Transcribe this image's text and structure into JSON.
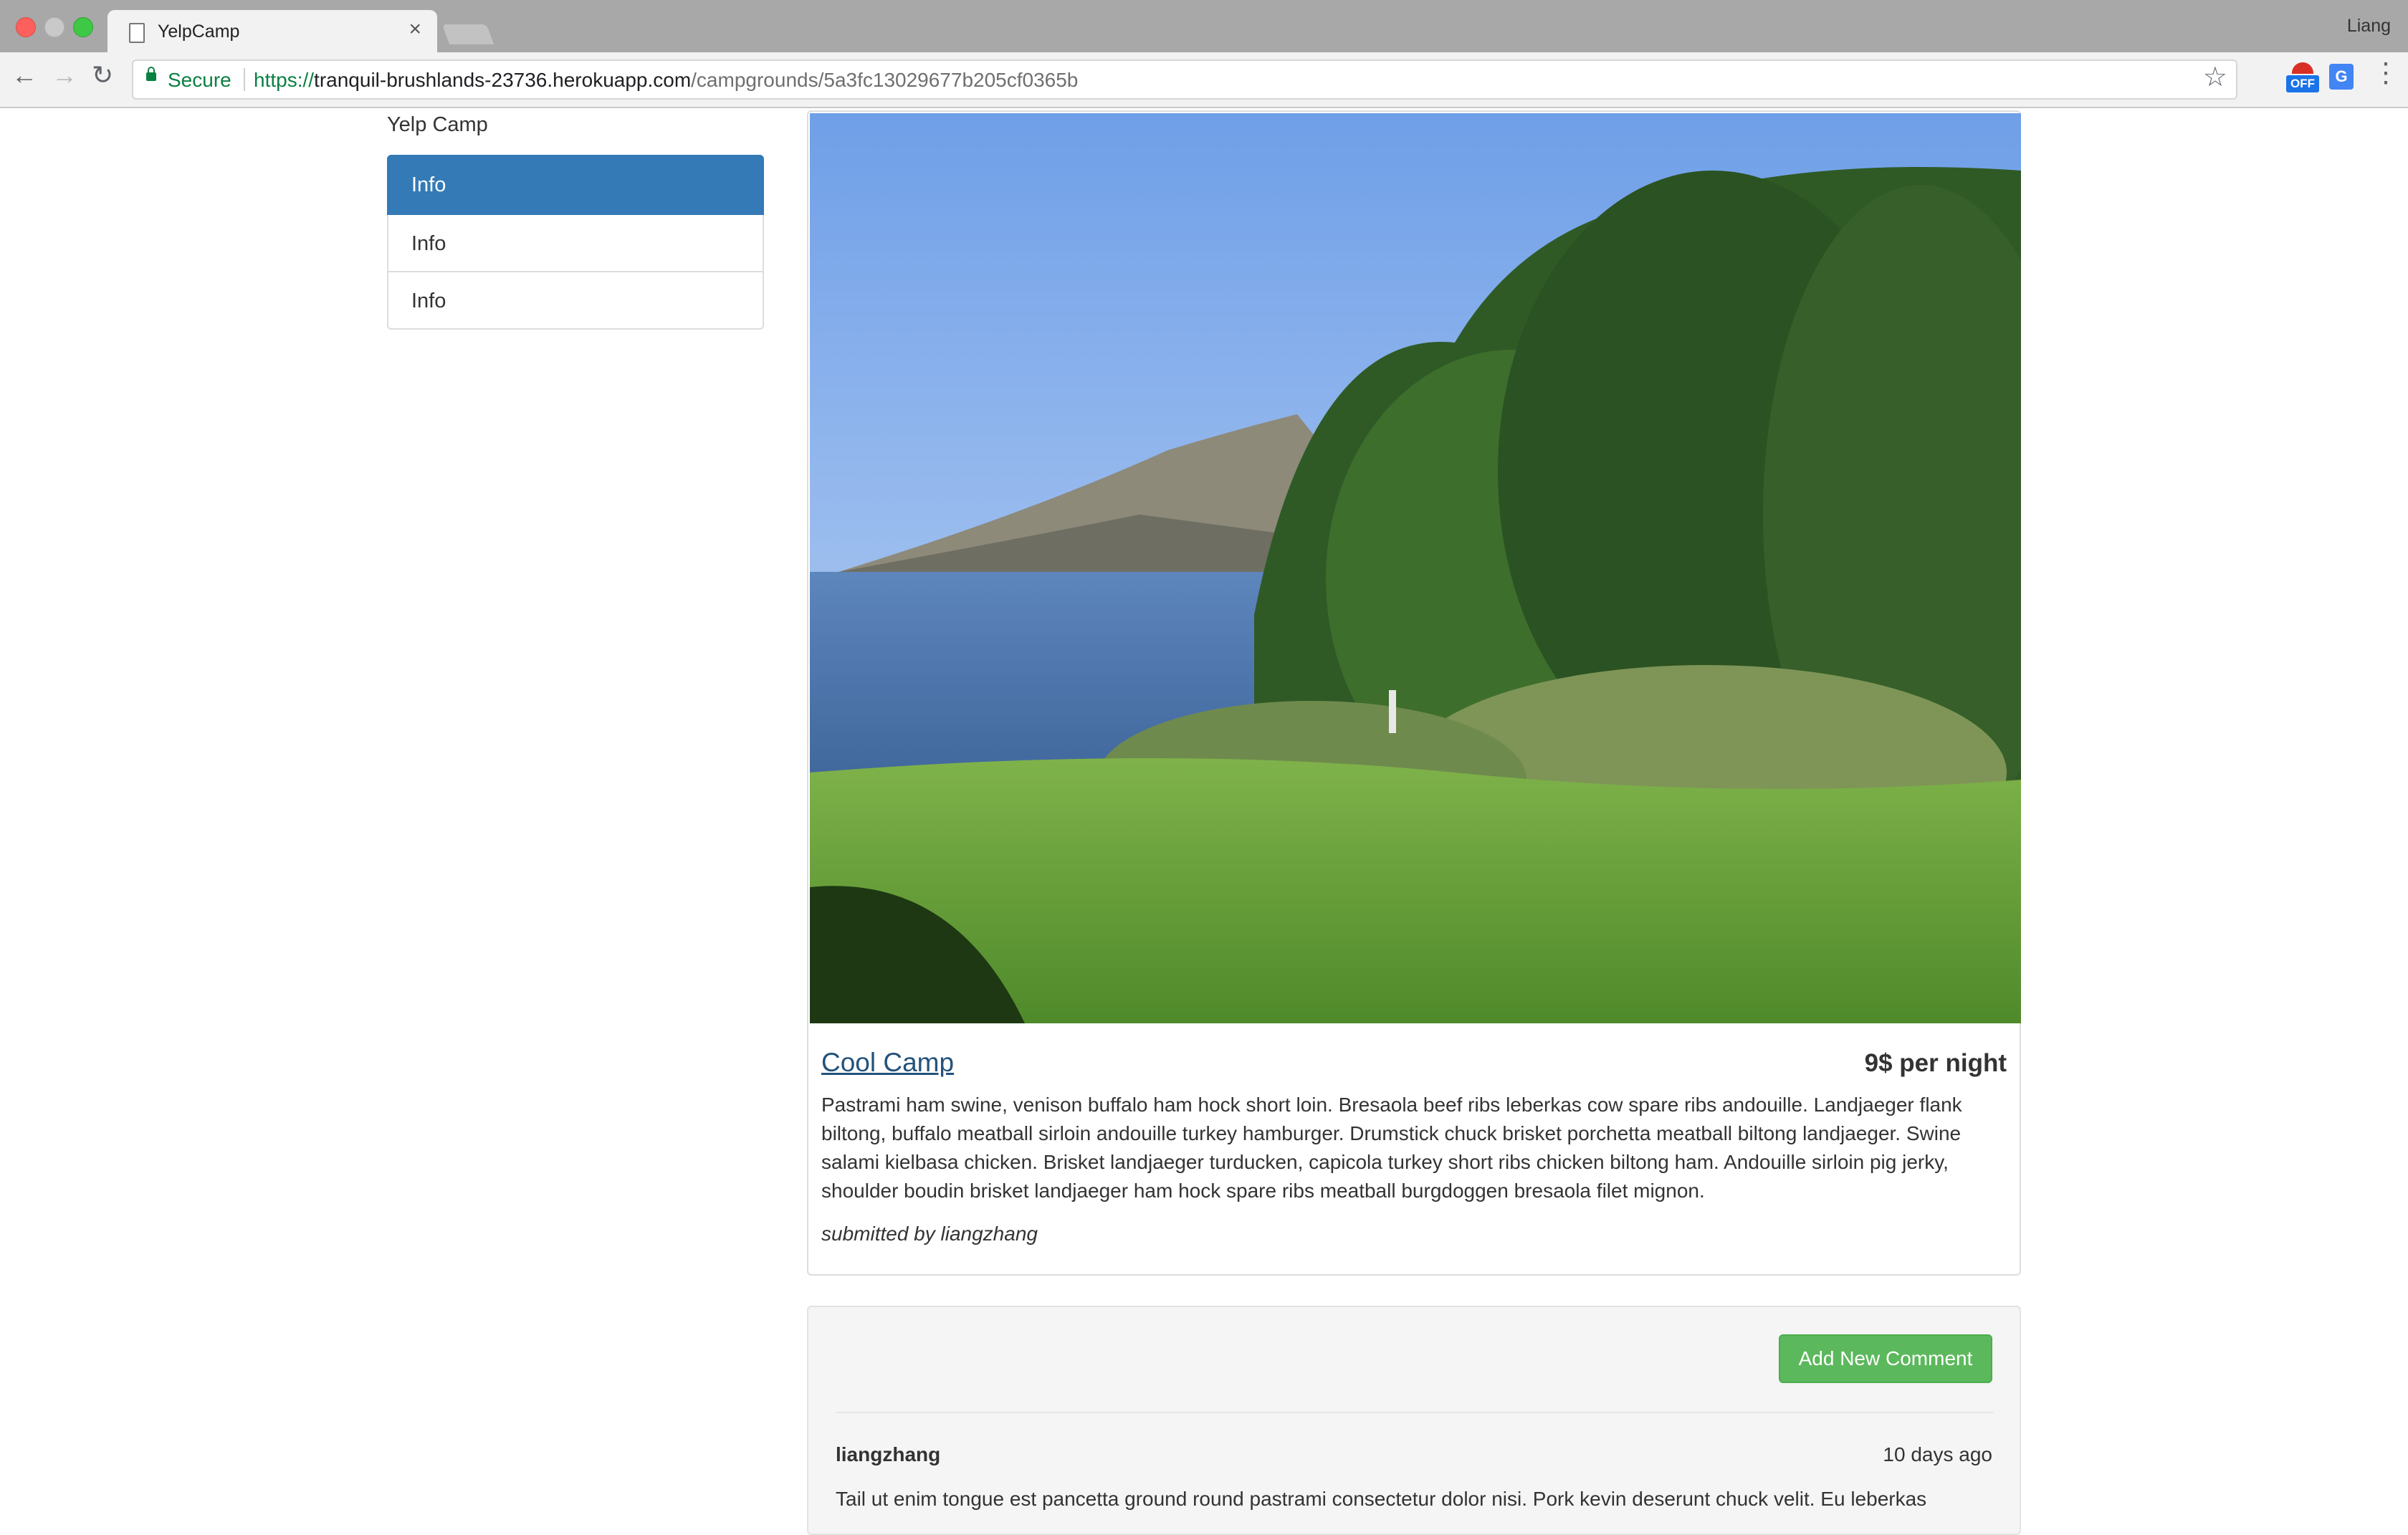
{
  "browser": {
    "tab_title": "YelpCamp",
    "tab_close": "×",
    "profile_name": "Liang",
    "secure_label": "Secure",
    "url_scheme": "https://",
    "url_host": "tranquil-brushlands-23736.herokuapp.com",
    "url_path": "/campgrounds/5a3fc13029677b205cf0365b",
    "extension_badge": "OFF"
  },
  "sidebar": {
    "brand": "Yelp Camp",
    "items": [
      {
        "label": "Info",
        "active": true
      },
      {
        "label": "Info",
        "active": false
      },
      {
        "label": "Info",
        "active": false
      }
    ]
  },
  "campground": {
    "name": "Cool Camp",
    "price": "9$ per night",
    "description": "Pastrami ham swine, venison buffalo ham hock short loin. Bresaola beef ribs leberkas cow spare ribs andouille. Landjaeger flank biltong, buffalo meatball sirloin andouille turkey hamburger. Drumstick chuck brisket porchetta meatball biltong landjaeger. Swine salami kielbasa chicken. Brisket landjaeger turducken, capicola turkey short ribs chicken biltong ham. Andouille sirloin pig jerky, shoulder boudin brisket landjaeger ham hock spare ribs meatball burgdoggen bresaola filet mignon.",
    "submitted_by": "submitted by liangzhang"
  },
  "comments": {
    "add_button": "Add New Comment",
    "items": [
      {
        "author": "liangzhang",
        "time": "10 days ago",
        "text": "Tail ut enim tongue est pancetta ground round pastrami consectetur dolor nisi. Pork kevin deserunt chuck velit. Eu leberkas"
      }
    ]
  },
  "colors": {
    "active_item": "#337ab7",
    "link": "#23527c",
    "success_button": "#5cb85c",
    "secure_green": "#0b8043"
  }
}
